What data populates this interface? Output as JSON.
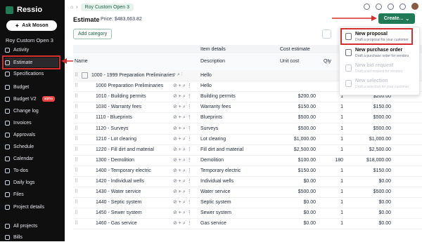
{
  "app": {
    "name": "Ressio"
  },
  "sidebar": {
    "ask_label": "Ask Moson",
    "project_name": "Roy Custom Open 3",
    "items": [
      {
        "label": "Activity"
      },
      {
        "label": "Estimate"
      },
      {
        "label": "Specifications"
      },
      {
        "label": "Budget"
      },
      {
        "label": "Budget V2",
        "badge": "alpha"
      },
      {
        "label": "Change log"
      },
      {
        "label": "Invoices"
      },
      {
        "label": "Approvals"
      },
      {
        "label": "Schedule"
      },
      {
        "label": "Calendar"
      },
      {
        "label": "To-dos"
      },
      {
        "label": "Daily logs"
      },
      {
        "label": "Files"
      },
      {
        "label": "Project details"
      },
      {
        "label": "All projects"
      },
      {
        "label": "Bills"
      }
    ]
  },
  "header": {
    "breadcrumb_project": "Roy Custom Open 3",
    "title": "Estimate",
    "price": "Price: $483,663.82",
    "create_label": "Create...",
    "add_category": "Add category"
  },
  "table": {
    "group_headers": {
      "item_details": "Item details",
      "cost_estimate": "Cost estimate"
    },
    "columns": {
      "name": "Name",
      "description": "Description",
      "unit_cost": "Unit cost",
      "qty": "Qty"
    },
    "rows": [
      {
        "name": "1000 - 1999 Preparation Preliminaries",
        "description": "Hello",
        "unit_cost": "",
        "qty": "",
        "total": "",
        "group": true
      },
      {
        "name": "1000 Preparation Preliminaries",
        "description": "Hello",
        "unit_cost": "",
        "qty": "",
        "total": ""
      },
      {
        "name": "1010 - Building permits",
        "description": "Building permits",
        "unit_cost": "$200.00",
        "qty": "1",
        "total": "$200.00"
      },
      {
        "name": "1030 - Warranty fees",
        "description": "Warranty fees",
        "unit_cost": "$150.00",
        "qty": "1",
        "total": "$150.00"
      },
      {
        "name": "1110 - Blueprints",
        "description": "Blueprints",
        "unit_cost": "$500.00",
        "qty": "1",
        "total": "$500.00"
      },
      {
        "name": "1120 - Surveys",
        "description": "Surveys",
        "unit_cost": "$500.00",
        "qty": "1",
        "total": "$500.00"
      },
      {
        "name": "1210 - Lot clearing",
        "description": "Lot clearing",
        "unit_cost": "$1,000.00",
        "qty": "1",
        "total": "$1,000.00"
      },
      {
        "name": "1220 - Fill dirt and material",
        "description": "Fill dirt and material",
        "unit_cost": "$2,500.00",
        "qty": "1",
        "total": "$2,500.00"
      },
      {
        "name": "1300 - Demolition",
        "description": "Demolition",
        "unit_cost": "$100.00",
        "qty": "180",
        "total": "$18,000.00"
      },
      {
        "name": "1400 - Temporary electric",
        "description": "Temporary electric",
        "unit_cost": "$150.00",
        "qty": "1",
        "total": "$150.00"
      },
      {
        "name": "1420 - Individual wells",
        "description": "Individual wells",
        "unit_cost": "$0.00",
        "qty": "1",
        "total": "$0.00"
      },
      {
        "name": "1430 - Water service",
        "description": "Water service",
        "unit_cost": "$500.00",
        "qty": "1",
        "total": "$500.00"
      },
      {
        "name": "1440 - Septic system",
        "description": "Septic system",
        "unit_cost": "$0.00",
        "qty": "1",
        "total": "$0.00"
      },
      {
        "name": "1450 - Sewer system",
        "description": "Sewer system",
        "unit_cost": "$0.00",
        "qty": "1",
        "total": "$0.00"
      },
      {
        "name": "1460 - Gas service",
        "description": "Gas service",
        "unit_cost": "$0.00",
        "qty": "1",
        "total": "$0.00"
      }
    ]
  },
  "dropdown": {
    "items": [
      {
        "title": "New proposal",
        "sub": "Draft a proposal for your customer"
      },
      {
        "title": "New purchase order",
        "sub": "Draft a purchase order for vendors"
      },
      {
        "title": "New bid request",
        "sub": "Draft a bid request for vendors",
        "disabled": true
      },
      {
        "title": "New selection",
        "sub": "Draft a selection for your customer",
        "disabled": true
      }
    ]
  },
  "colors": {
    "brand": "#1f7a55",
    "annotation": "#d32f2f"
  }
}
